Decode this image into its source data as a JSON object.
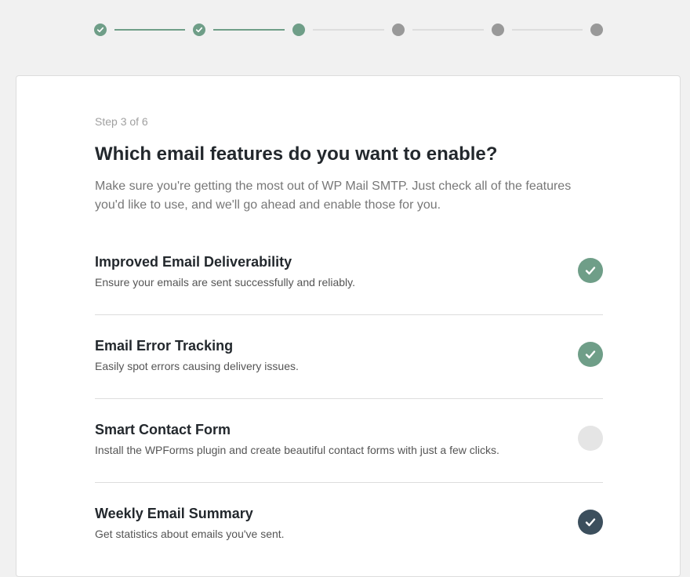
{
  "stepper": {
    "total_steps": 6,
    "current_step": 3,
    "steps": [
      {
        "state": "done"
      },
      {
        "state": "done"
      },
      {
        "state": "current"
      },
      {
        "state": "upcoming"
      },
      {
        "state": "upcoming"
      },
      {
        "state": "upcoming"
      }
    ]
  },
  "step_label": "Step 3 of 6",
  "title": "Which email features do you want to enable?",
  "description": "Make sure you're getting the most out of WP Mail SMTP. Just check all of the features you'd like to use, and we'll go ahead and enable those for you.",
  "features": [
    {
      "title": "Improved Email Deliverability",
      "description": "Ensure your emails are sent successfully and reliably.",
      "state": "on",
      "icon": "checkmark-icon"
    },
    {
      "title": "Email Error Tracking",
      "description": "Easily spot errors causing delivery issues.",
      "state": "on",
      "icon": "checkmark-icon"
    },
    {
      "title": "Smart Contact Form",
      "description": "Install the WPForms plugin and create beautiful contact forms with just a few clicks.",
      "state": "off",
      "icon": "checkmark-icon"
    },
    {
      "title": "Weekly Email Summary",
      "description": "Get statistics about emails you've sent.",
      "state": "locked",
      "icon": "checkmark-icon"
    }
  ],
  "colors": {
    "accent": "#6f9e88",
    "locked": "#3c4f5d",
    "unchecked": "#e5e5e5",
    "upcoming_step": "#999999",
    "line_inactive": "#dddddd"
  }
}
